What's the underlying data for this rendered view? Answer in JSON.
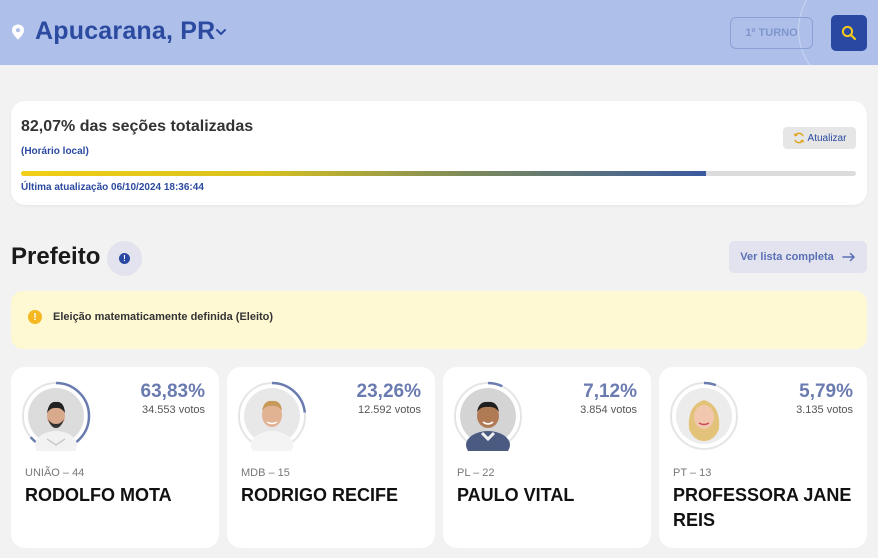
{
  "header": {
    "city": "Apucarana, PR",
    "round_label": "1º TURNO",
    "icons": {
      "location": "map-pin-icon",
      "dropdown": "chevron-down-icon",
      "search": "search-icon"
    }
  },
  "progress": {
    "title": "82,07% das seções totalizadas",
    "subtitle": "(Horário local)",
    "update_button": "Atualizar",
    "last_update": "Última atualização 06/10/2024 18:36:44",
    "percent": 82.07
  },
  "section": {
    "title": "Prefeito",
    "full_list_button": "Ver lista completa"
  },
  "notice": {
    "text": "Eleição matematicamente definida (Eleito)"
  },
  "colors": {
    "header_bg": "#aec0ea",
    "accent": "#2848a2",
    "notice_bg": "#fef8d3",
    "ring": "#6a7bb0"
  },
  "candidates": [
    {
      "percent_label": "63,83%",
      "votes_label": "34.553 votos",
      "party": "UNIÃO – 44",
      "name": "RODOLFO MOTA",
      "share": 63.83
    },
    {
      "percent_label": "23,26%",
      "votes_label": "12.592 votos",
      "party": "MDB – 15",
      "name": "RODRIGO RECIFE",
      "share": 23.26
    },
    {
      "percent_label": "7,12%",
      "votes_label": "3.854 votos",
      "party": "PL – 22",
      "name": "PAULO VITAL",
      "share": 7.12
    },
    {
      "percent_label": "5,79%",
      "votes_label": "3.135 votos",
      "party": "PT – 13",
      "name": "PROFESSORA JANE REIS",
      "share": 5.79
    }
  ]
}
